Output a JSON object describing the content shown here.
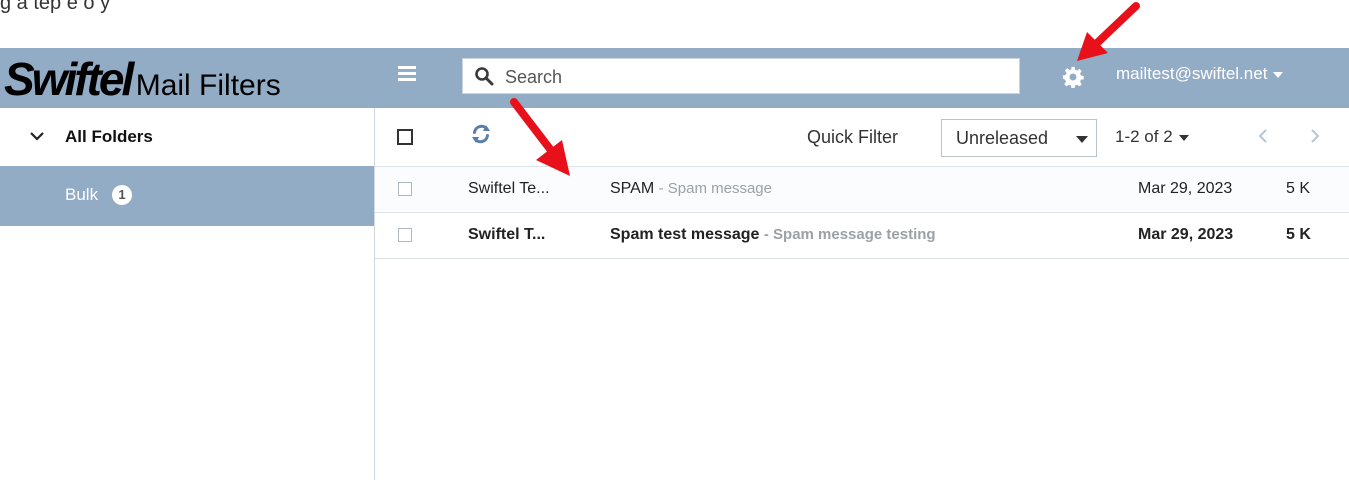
{
  "caption": "g a tep    e    o      y",
  "header": {
    "brand_logo": "Swiftel",
    "brand_text": "Mail Filters",
    "search_placeholder": "Search",
    "account": "mailtest@swiftel.net"
  },
  "sidebar": {
    "folder_header": "All Folders",
    "folders": [
      {
        "label": "Bulk",
        "count": "1"
      }
    ]
  },
  "toolbar": {
    "quick_filter_label": "Quick Filter",
    "quick_filter_value": "Unreleased",
    "pagination": "1-2 of 2"
  },
  "messages": [
    {
      "sender": "Swiftel Te...",
      "subject": "SPAM",
      "preview": "- Spam message",
      "date": "Mar 29, 2023",
      "size": "5 K",
      "unread": false
    },
    {
      "sender": "Swiftel T...",
      "subject": "Spam test message",
      "preview": "- Spam message testing",
      "date": "Mar 29, 2023",
      "size": "5 K",
      "unread": true
    }
  ],
  "colors": {
    "header_bg": "#93acc6",
    "selected_folder_bg": "#93acc6",
    "refresh_icon": "#5b7ea8",
    "annotation_arrow": "#e8111b"
  },
  "icons": {
    "menu": "hamburger-menu-icon",
    "search": "search-icon",
    "settings": "gear-icon",
    "expand": "chevron-down-icon",
    "refresh": "refresh-icon",
    "previous": "chevron-left-icon",
    "next": "chevron-right-icon"
  }
}
